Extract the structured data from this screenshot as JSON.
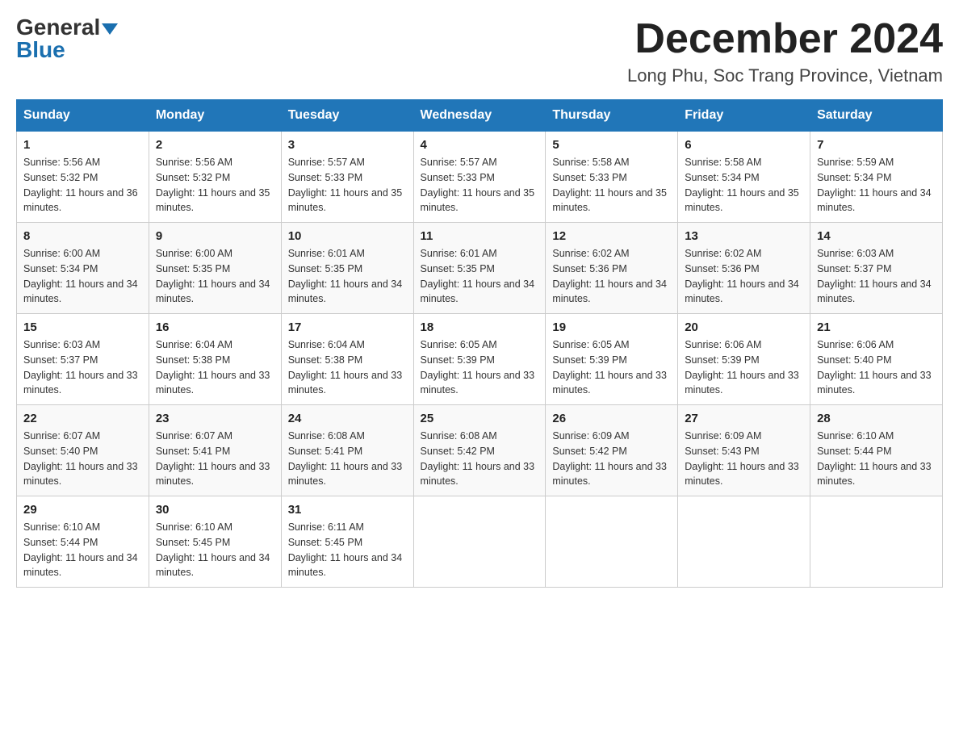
{
  "header": {
    "logo_line1": "General",
    "logo_line2": "Blue",
    "month_title": "December 2024",
    "location": "Long Phu, Soc Trang Province, Vietnam"
  },
  "days_of_week": [
    "Sunday",
    "Monday",
    "Tuesday",
    "Wednesday",
    "Thursday",
    "Friday",
    "Saturday"
  ],
  "weeks": [
    [
      {
        "day": "1",
        "sunrise": "Sunrise: 5:56 AM",
        "sunset": "Sunset: 5:32 PM",
        "daylight": "Daylight: 11 hours and 36 minutes."
      },
      {
        "day": "2",
        "sunrise": "Sunrise: 5:56 AM",
        "sunset": "Sunset: 5:32 PM",
        "daylight": "Daylight: 11 hours and 35 minutes."
      },
      {
        "day": "3",
        "sunrise": "Sunrise: 5:57 AM",
        "sunset": "Sunset: 5:33 PM",
        "daylight": "Daylight: 11 hours and 35 minutes."
      },
      {
        "day": "4",
        "sunrise": "Sunrise: 5:57 AM",
        "sunset": "Sunset: 5:33 PM",
        "daylight": "Daylight: 11 hours and 35 minutes."
      },
      {
        "day": "5",
        "sunrise": "Sunrise: 5:58 AM",
        "sunset": "Sunset: 5:33 PM",
        "daylight": "Daylight: 11 hours and 35 minutes."
      },
      {
        "day": "6",
        "sunrise": "Sunrise: 5:58 AM",
        "sunset": "Sunset: 5:34 PM",
        "daylight": "Daylight: 11 hours and 35 minutes."
      },
      {
        "day": "7",
        "sunrise": "Sunrise: 5:59 AM",
        "sunset": "Sunset: 5:34 PM",
        "daylight": "Daylight: 11 hours and 34 minutes."
      }
    ],
    [
      {
        "day": "8",
        "sunrise": "Sunrise: 6:00 AM",
        "sunset": "Sunset: 5:34 PM",
        "daylight": "Daylight: 11 hours and 34 minutes."
      },
      {
        "day": "9",
        "sunrise": "Sunrise: 6:00 AM",
        "sunset": "Sunset: 5:35 PM",
        "daylight": "Daylight: 11 hours and 34 minutes."
      },
      {
        "day": "10",
        "sunrise": "Sunrise: 6:01 AM",
        "sunset": "Sunset: 5:35 PM",
        "daylight": "Daylight: 11 hours and 34 minutes."
      },
      {
        "day": "11",
        "sunrise": "Sunrise: 6:01 AM",
        "sunset": "Sunset: 5:35 PM",
        "daylight": "Daylight: 11 hours and 34 minutes."
      },
      {
        "day": "12",
        "sunrise": "Sunrise: 6:02 AM",
        "sunset": "Sunset: 5:36 PM",
        "daylight": "Daylight: 11 hours and 34 minutes."
      },
      {
        "day": "13",
        "sunrise": "Sunrise: 6:02 AM",
        "sunset": "Sunset: 5:36 PM",
        "daylight": "Daylight: 11 hours and 34 minutes."
      },
      {
        "day": "14",
        "sunrise": "Sunrise: 6:03 AM",
        "sunset": "Sunset: 5:37 PM",
        "daylight": "Daylight: 11 hours and 34 minutes."
      }
    ],
    [
      {
        "day": "15",
        "sunrise": "Sunrise: 6:03 AM",
        "sunset": "Sunset: 5:37 PM",
        "daylight": "Daylight: 11 hours and 33 minutes."
      },
      {
        "day": "16",
        "sunrise": "Sunrise: 6:04 AM",
        "sunset": "Sunset: 5:38 PM",
        "daylight": "Daylight: 11 hours and 33 minutes."
      },
      {
        "day": "17",
        "sunrise": "Sunrise: 6:04 AM",
        "sunset": "Sunset: 5:38 PM",
        "daylight": "Daylight: 11 hours and 33 minutes."
      },
      {
        "day": "18",
        "sunrise": "Sunrise: 6:05 AM",
        "sunset": "Sunset: 5:39 PM",
        "daylight": "Daylight: 11 hours and 33 minutes."
      },
      {
        "day": "19",
        "sunrise": "Sunrise: 6:05 AM",
        "sunset": "Sunset: 5:39 PM",
        "daylight": "Daylight: 11 hours and 33 minutes."
      },
      {
        "day": "20",
        "sunrise": "Sunrise: 6:06 AM",
        "sunset": "Sunset: 5:39 PM",
        "daylight": "Daylight: 11 hours and 33 minutes."
      },
      {
        "day": "21",
        "sunrise": "Sunrise: 6:06 AM",
        "sunset": "Sunset: 5:40 PM",
        "daylight": "Daylight: 11 hours and 33 minutes."
      }
    ],
    [
      {
        "day": "22",
        "sunrise": "Sunrise: 6:07 AM",
        "sunset": "Sunset: 5:40 PM",
        "daylight": "Daylight: 11 hours and 33 minutes."
      },
      {
        "day": "23",
        "sunrise": "Sunrise: 6:07 AM",
        "sunset": "Sunset: 5:41 PM",
        "daylight": "Daylight: 11 hours and 33 minutes."
      },
      {
        "day": "24",
        "sunrise": "Sunrise: 6:08 AM",
        "sunset": "Sunset: 5:41 PM",
        "daylight": "Daylight: 11 hours and 33 minutes."
      },
      {
        "day": "25",
        "sunrise": "Sunrise: 6:08 AM",
        "sunset": "Sunset: 5:42 PM",
        "daylight": "Daylight: 11 hours and 33 minutes."
      },
      {
        "day": "26",
        "sunrise": "Sunrise: 6:09 AM",
        "sunset": "Sunset: 5:42 PM",
        "daylight": "Daylight: 11 hours and 33 minutes."
      },
      {
        "day": "27",
        "sunrise": "Sunrise: 6:09 AM",
        "sunset": "Sunset: 5:43 PM",
        "daylight": "Daylight: 11 hours and 33 minutes."
      },
      {
        "day": "28",
        "sunrise": "Sunrise: 6:10 AM",
        "sunset": "Sunset: 5:44 PM",
        "daylight": "Daylight: 11 hours and 33 minutes."
      }
    ],
    [
      {
        "day": "29",
        "sunrise": "Sunrise: 6:10 AM",
        "sunset": "Sunset: 5:44 PM",
        "daylight": "Daylight: 11 hours and 34 minutes."
      },
      {
        "day": "30",
        "sunrise": "Sunrise: 6:10 AM",
        "sunset": "Sunset: 5:45 PM",
        "daylight": "Daylight: 11 hours and 34 minutes."
      },
      {
        "day": "31",
        "sunrise": "Sunrise: 6:11 AM",
        "sunset": "Sunset: 5:45 PM",
        "daylight": "Daylight: 11 hours and 34 minutes."
      },
      null,
      null,
      null,
      null
    ]
  ]
}
